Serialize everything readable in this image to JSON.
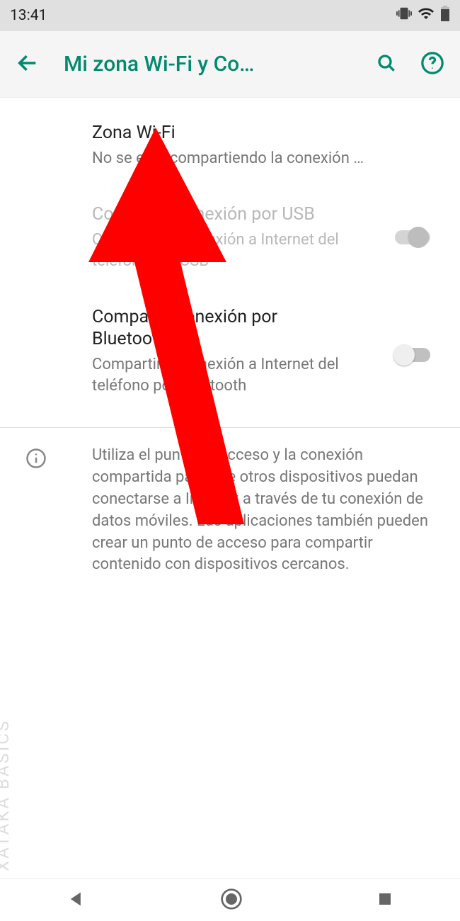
{
  "status": {
    "time": "13:41"
  },
  "header": {
    "title": "Mi zona Wi-Fi y Co…"
  },
  "rows": {
    "wifi": {
      "title": "Zona Wi-Fi",
      "subtitle": "No se está compartiendo la conexión a Internet ni el contenido con otros dispos…"
    },
    "usb": {
      "title": "Compartir conexión por USB",
      "subtitle": "Compartir la conexión a Internet del teléfono por USB"
    },
    "bluetooth": {
      "title": "Compartir conexión por Bluetooth",
      "subtitle": "Compartir la conexión a Internet del teléfono por Bluetooth"
    }
  },
  "info": {
    "text": "Utiliza el punto de acceso y la conexión compartida para que otros dispositivos puedan conectarse a Internet a través de tu conexión de datos móviles. Las aplicaciones también pueden crear un punto de acceso para compartir contenido con dispositivos cercanos."
  },
  "watermark": "XATAKA BASICS"
}
